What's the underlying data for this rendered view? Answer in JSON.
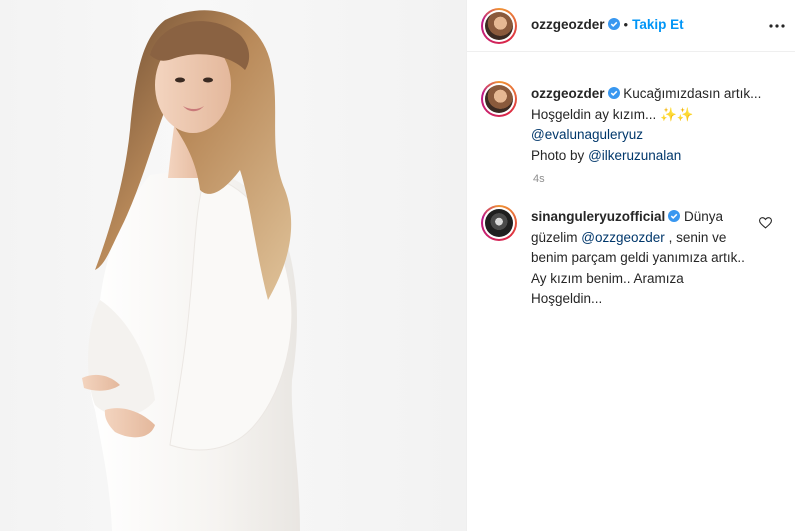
{
  "post": {
    "username": "ozzgeozder",
    "follow_label": "Takip Et",
    "separator": "•"
  },
  "caption": {
    "username": "ozzgeozder",
    "line1": "Kucağımızdasın artık...",
    "line2": "Hoşgeldin ay kızım...",
    "emoji": "✨✨",
    "mention": "@evalunaguleryuz",
    "photo_prefix": "Photo by",
    "photo_mention": "@ilkeruzunalan",
    "time": "4s"
  },
  "comment": {
    "username": "sinanguleryuzofficial",
    "text_a": "Dünya",
    "text_b": "güzelim",
    "mention": "@ozzgeozder",
    "text_c": ", senin ve benim parçam geldi yanımıza artık.. Ay kızım benim.. Aramıza Hoşgeldin..."
  },
  "icons": {
    "verified": "verified-badge-icon",
    "more": "more-options-icon",
    "heart": "heart-icon"
  },
  "colors": {
    "link_blue": "#0095f6",
    "mention": "#00376b",
    "verified": "#3897f0",
    "muted": "#8e8e8e"
  }
}
